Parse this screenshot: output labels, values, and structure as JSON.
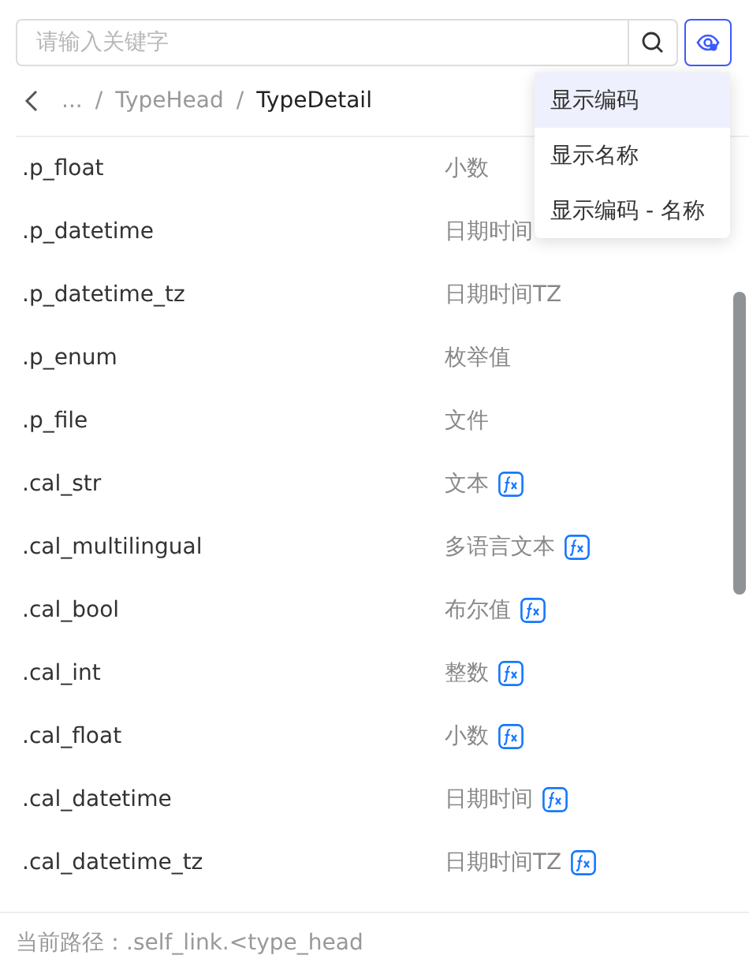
{
  "search": {
    "placeholder": "请输入关键字"
  },
  "breadcrumb": {
    "separator": "/",
    "items": [
      {
        "label": "...",
        "current": false
      },
      {
        "label": "TypeHead",
        "current": false
      },
      {
        "label": "TypeDetail",
        "current": true
      }
    ]
  },
  "display_menu": {
    "items": [
      {
        "label": "显示编码",
        "selected": true
      },
      {
        "label": "显示名称",
        "selected": false
      },
      {
        "label": "显示编码 - 名称",
        "selected": false
      }
    ]
  },
  "fields": [
    {
      "code": ".p_float",
      "name": "小数",
      "formula": false
    },
    {
      "code": ".p_datetime",
      "name": "日期时间",
      "formula": false
    },
    {
      "code": ".p_datetime_tz",
      "name": "日期时间TZ",
      "formula": false
    },
    {
      "code": ".p_enum",
      "name": "枚举值",
      "formula": false
    },
    {
      "code": ".p_file",
      "name": "文件",
      "formula": false
    },
    {
      "code": ".cal_str",
      "name": "文本",
      "formula": true
    },
    {
      "code": ".cal_multilingual",
      "name": "多语言文本",
      "formula": true
    },
    {
      "code": ".cal_bool",
      "name": "布尔值",
      "formula": true
    },
    {
      "code": ".cal_int",
      "name": "整数",
      "formula": true
    },
    {
      "code": ".cal_float",
      "name": "小数",
      "formula": true
    },
    {
      "code": ".cal_datetime",
      "name": "日期时间",
      "formula": true
    },
    {
      "code": ".cal_datetime_tz",
      "name": "日期时间TZ",
      "formula": true
    }
  ],
  "status_bar": {
    "label": "当前路径：",
    "path": ".self_link.<type_head"
  }
}
